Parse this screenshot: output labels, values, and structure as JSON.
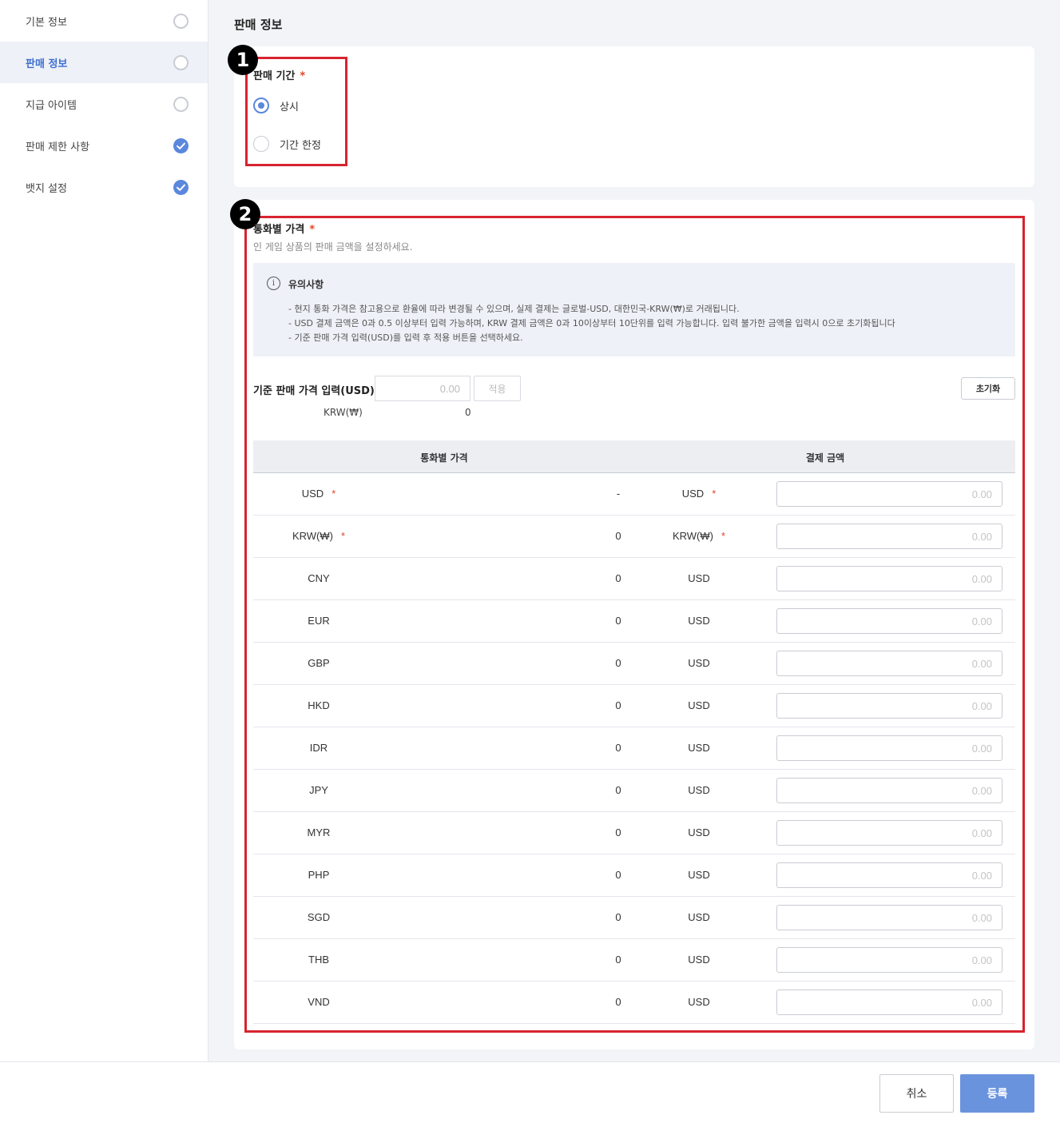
{
  "sidebar": {
    "items": [
      {
        "label": "기본 정보",
        "status": "empty",
        "active": false
      },
      {
        "label": "판매 정보",
        "status": "empty",
        "active": true
      },
      {
        "label": "지급 아이템",
        "status": "empty",
        "active": false
      },
      {
        "label": "판매 제한 사항",
        "status": "done",
        "active": false
      },
      {
        "label": "뱃지 설정",
        "status": "done",
        "active": false
      }
    ]
  },
  "main": {
    "title": "판매 정보"
  },
  "callouts": [
    "1",
    "2"
  ],
  "sale_period": {
    "label": "판매 기간",
    "required_mark": "*",
    "options": [
      {
        "label": "상시",
        "checked": true
      },
      {
        "label": "기간 한정",
        "checked": false
      }
    ]
  },
  "currency_price": {
    "label": "통화별 가격",
    "required_mark": "*",
    "description": "인 게임 상품의 판매 금액을 설정하세요.",
    "notice": {
      "icon": "info-icon",
      "title": "유의사항",
      "lines": [
        "- 현지 통화 가격은 참고용으로 환율에 따라 변경될 수 있으며, 실제 결제는 글로벌-USD, 대한민국-KRW(₩)로 거래됩니다.",
        "- USD 결제 금액은 0과 0.5 이상부터 입력 가능하며, KRW 결제 금액은 0과 10이상부터 10단위를 입력 가능합니다. 입력 불가한 금액을 입력시 0으로 초기화됩니다",
        "- 기준 판매 가격 입력(USD)를 입력 후 적용 버튼을 선택하세요."
      ]
    },
    "base_price_label": "기준 판매 가격 입력(USD)",
    "base_price_placeholder": "0.00",
    "apply_label": "적용",
    "reset_label": "초기화",
    "krw_label": "KRW(₩)",
    "krw_value": "0",
    "table": {
      "col_currency": "통화별 가격",
      "col_payment": "결제 금액",
      "input_placeholder": "0.00",
      "rows": [
        {
          "currency": "USD",
          "required": true,
          "value": "-",
          "pay_currency": "USD",
          "pay_required": true
        },
        {
          "currency": "KRW(₩)",
          "required": true,
          "value": "0",
          "pay_currency": "KRW(₩)",
          "pay_required": true
        },
        {
          "currency": "CNY",
          "required": false,
          "value": "0",
          "pay_currency": "USD",
          "pay_required": false
        },
        {
          "currency": "EUR",
          "required": false,
          "value": "0",
          "pay_currency": "USD",
          "pay_required": false
        },
        {
          "currency": "GBP",
          "required": false,
          "value": "0",
          "pay_currency": "USD",
          "pay_required": false
        },
        {
          "currency": "HKD",
          "required": false,
          "value": "0",
          "pay_currency": "USD",
          "pay_required": false
        },
        {
          "currency": "IDR",
          "required": false,
          "value": "0",
          "pay_currency": "USD",
          "pay_required": false
        },
        {
          "currency": "JPY",
          "required": false,
          "value": "0",
          "pay_currency": "USD",
          "pay_required": false
        },
        {
          "currency": "MYR",
          "required": false,
          "value": "0",
          "pay_currency": "USD",
          "pay_required": false
        },
        {
          "currency": "PHP",
          "required": false,
          "value": "0",
          "pay_currency": "USD",
          "pay_required": false
        },
        {
          "currency": "SGD",
          "required": false,
          "value": "0",
          "pay_currency": "USD",
          "pay_required": false
        },
        {
          "currency": "THB",
          "required": false,
          "value": "0",
          "pay_currency": "USD",
          "pay_required": false
        },
        {
          "currency": "VND",
          "required": false,
          "value": "0",
          "pay_currency": "USD",
          "pay_required": false
        }
      ]
    }
  },
  "footer": {
    "cancel_label": "취소",
    "submit_label": "등록"
  },
  "colors": {
    "accent": "#5b87dc",
    "callout": "#d8232f",
    "required": "#e0452b",
    "submit": "#6a93de"
  }
}
